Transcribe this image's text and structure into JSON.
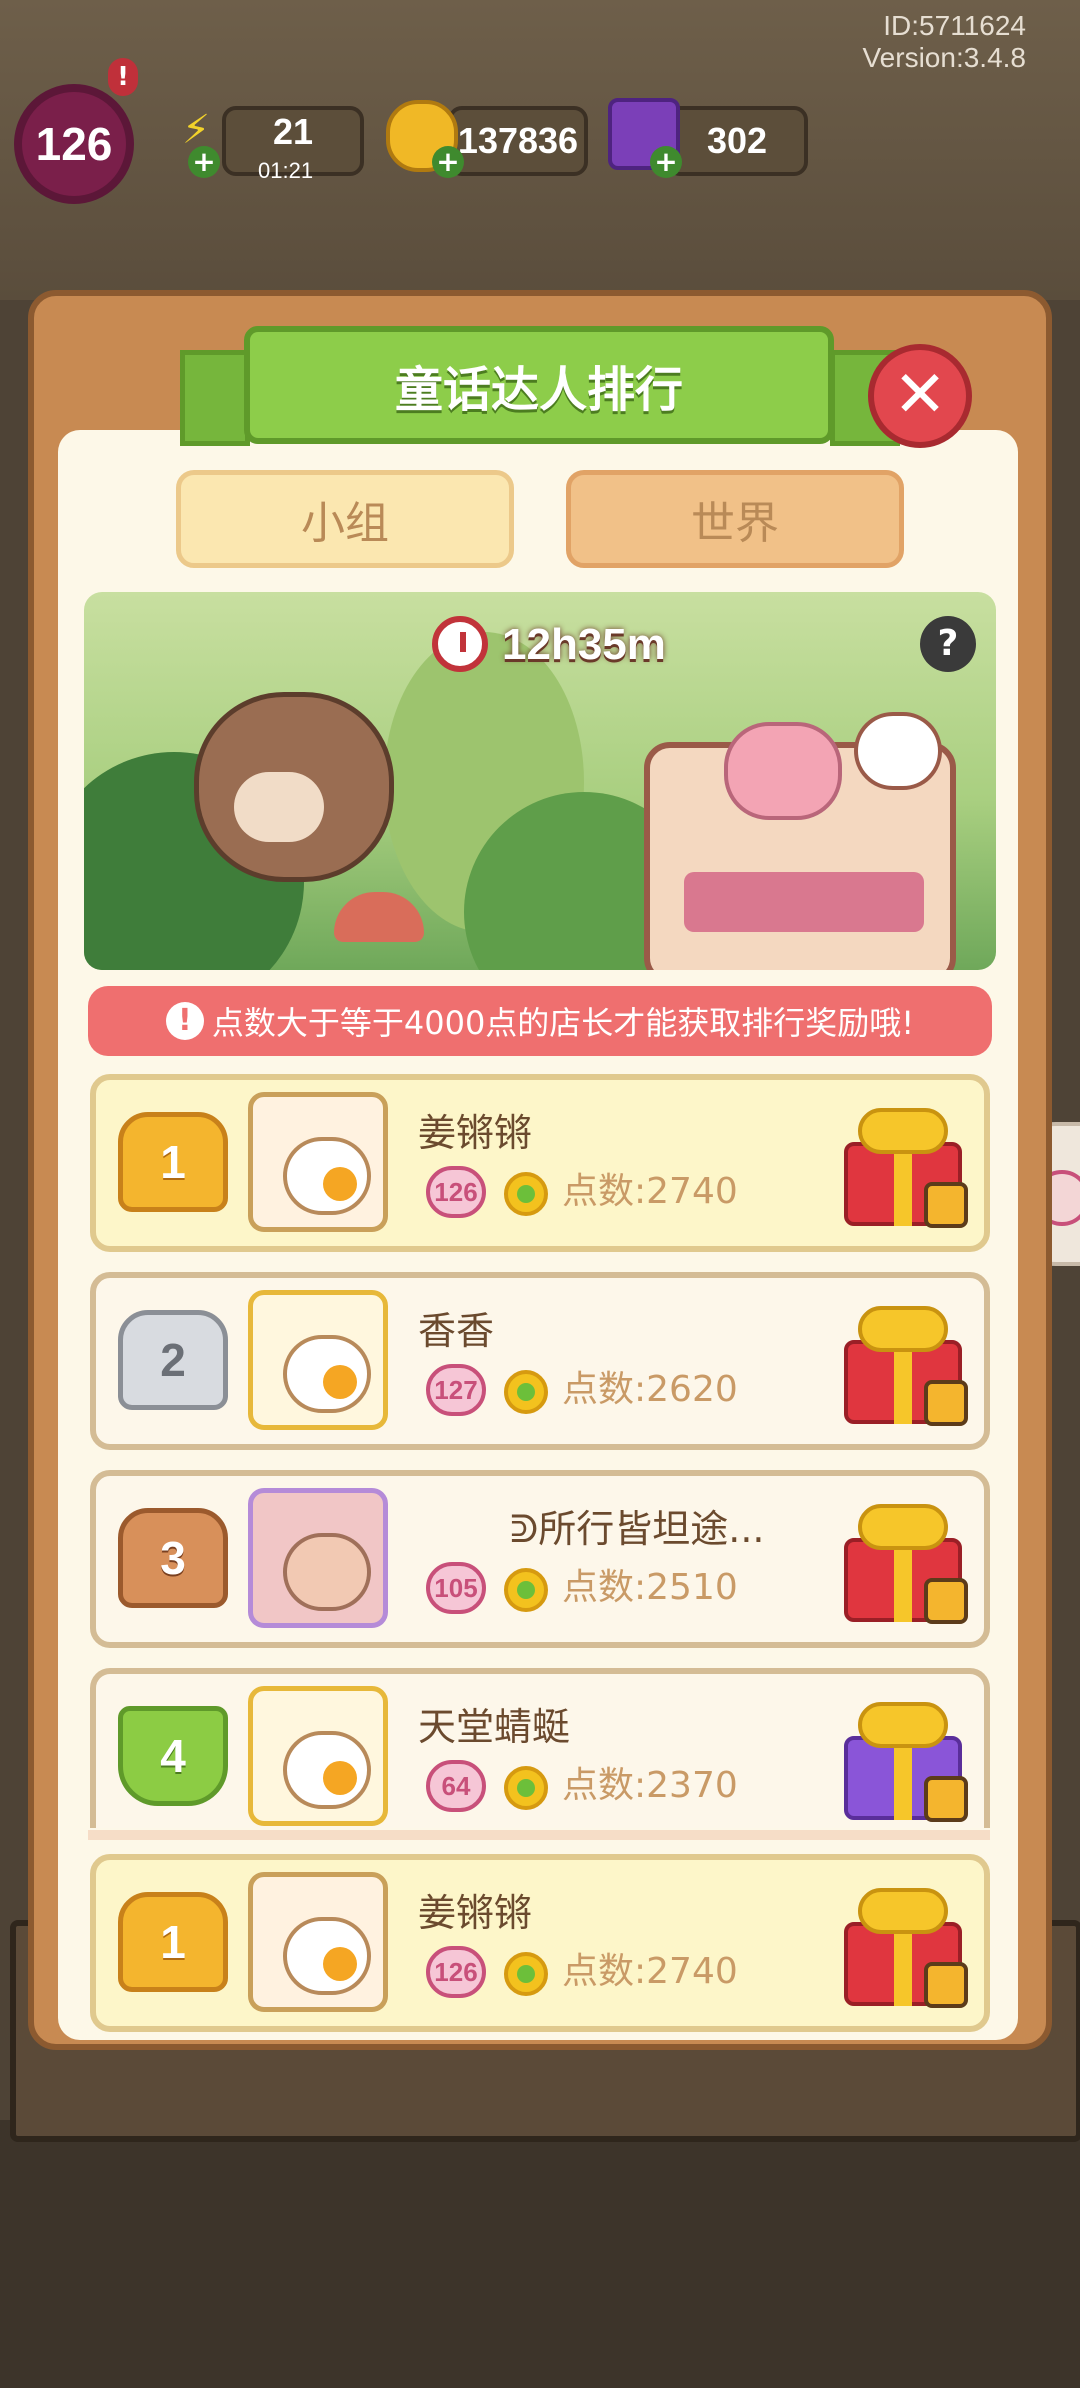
{
  "status": {
    "id_text": "ID:5711624",
    "version_text": "Version:3.4.8",
    "player_level": "126",
    "alert_mark": "!",
    "energy": "21",
    "energy_timer": "01:21",
    "coins": "137836",
    "gems": "302"
  },
  "dialog": {
    "title": "童话达人排行",
    "close_symbol": "✕",
    "tabs": [
      {
        "label": "小组",
        "selected": true
      },
      {
        "label": "世界",
        "selected": false
      }
    ],
    "banner_timer": "12h35m",
    "help_symbol": "?",
    "notice_icon": "!",
    "notice": "点数大于等于4000点的店长才能获取排行奖励哦!"
  },
  "rankings": [
    {
      "rank": "1",
      "name": "姜锵锵",
      "level": "126",
      "score": "点数:2740",
      "gift": "red-gift-locked"
    },
    {
      "rank": "2",
      "name": "香香",
      "level": "127",
      "score": "点数:2620",
      "gift": "red-gift-locked"
    },
    {
      "rank": "3",
      "name": "ᕲ所行皆坦途...",
      "level": "105",
      "score": "点数:2510",
      "gift": "red-gift-locked"
    },
    {
      "rank": "4",
      "name": "天堂蜻蜓",
      "level": "64",
      "score": "点数:2370",
      "gift": "purple-gift-locked"
    }
  ],
  "my_rank": {
    "rank": "1",
    "name": "姜锵锵",
    "level": "126",
    "score": "点数:2740",
    "gift": "red-gift-locked"
  },
  "colors": {
    "panel": "#c88a52",
    "ribbon": "#8dcd4a",
    "notice": "#ef6f6f",
    "close": "#e2474e"
  }
}
